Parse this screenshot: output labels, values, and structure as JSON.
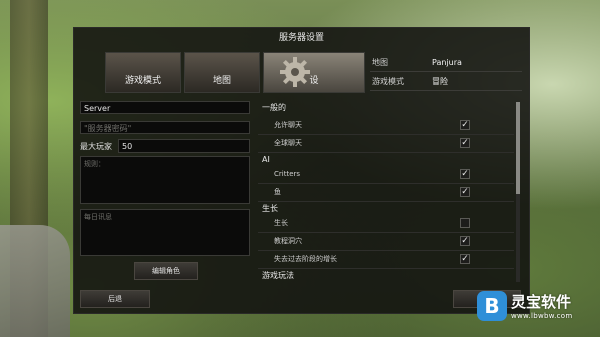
{
  "dialog": {
    "title": "服务器设置"
  },
  "tiles": [
    {
      "label": "游戏模式",
      "icon": "game-mode-image"
    },
    {
      "label": "地图",
      "icon": "map-image"
    },
    {
      "label": "",
      "icon": "gear-icon",
      "partial_label": "设"
    }
  ],
  "info": [
    {
      "key": "地图",
      "value": "Panjura"
    },
    {
      "key": "游戏模式",
      "value": "冒险"
    }
  ],
  "form": {
    "server_name": "Server",
    "password_placeholder": "\"服务器密码\"",
    "max_players_label": "最大玩家",
    "max_players_value": "50",
    "rules_placeholder": "规则：",
    "daily_message_placeholder": "每日讯息",
    "edit_roles_button": "编辑角色",
    "back_button": "后退"
  },
  "settings": [
    {
      "type": "category",
      "label": "一般的"
    },
    {
      "type": "item",
      "label": "允许聊天",
      "checked": true
    },
    {
      "type": "item",
      "label": "全球聊天",
      "checked": true
    },
    {
      "type": "category",
      "label": "AI"
    },
    {
      "type": "item",
      "label": "Critters",
      "checked": true
    },
    {
      "type": "item",
      "label": "鱼",
      "checked": true
    },
    {
      "type": "category",
      "label": "生长"
    },
    {
      "type": "item",
      "label": "生长",
      "checked": false
    },
    {
      "type": "item",
      "label": "教程洞穴",
      "checked": true
    },
    {
      "type": "item",
      "label": "失去过去阶段的增长",
      "checked": true
    },
    {
      "type": "category",
      "label": "游戏玩法"
    }
  ],
  "watermark": {
    "name": "灵宝软件",
    "url": "www.lbwbw.com",
    "badge": "B"
  },
  "colors": {
    "dialog_bg": "#121210",
    "accent_logo": "#2f8fd8"
  }
}
